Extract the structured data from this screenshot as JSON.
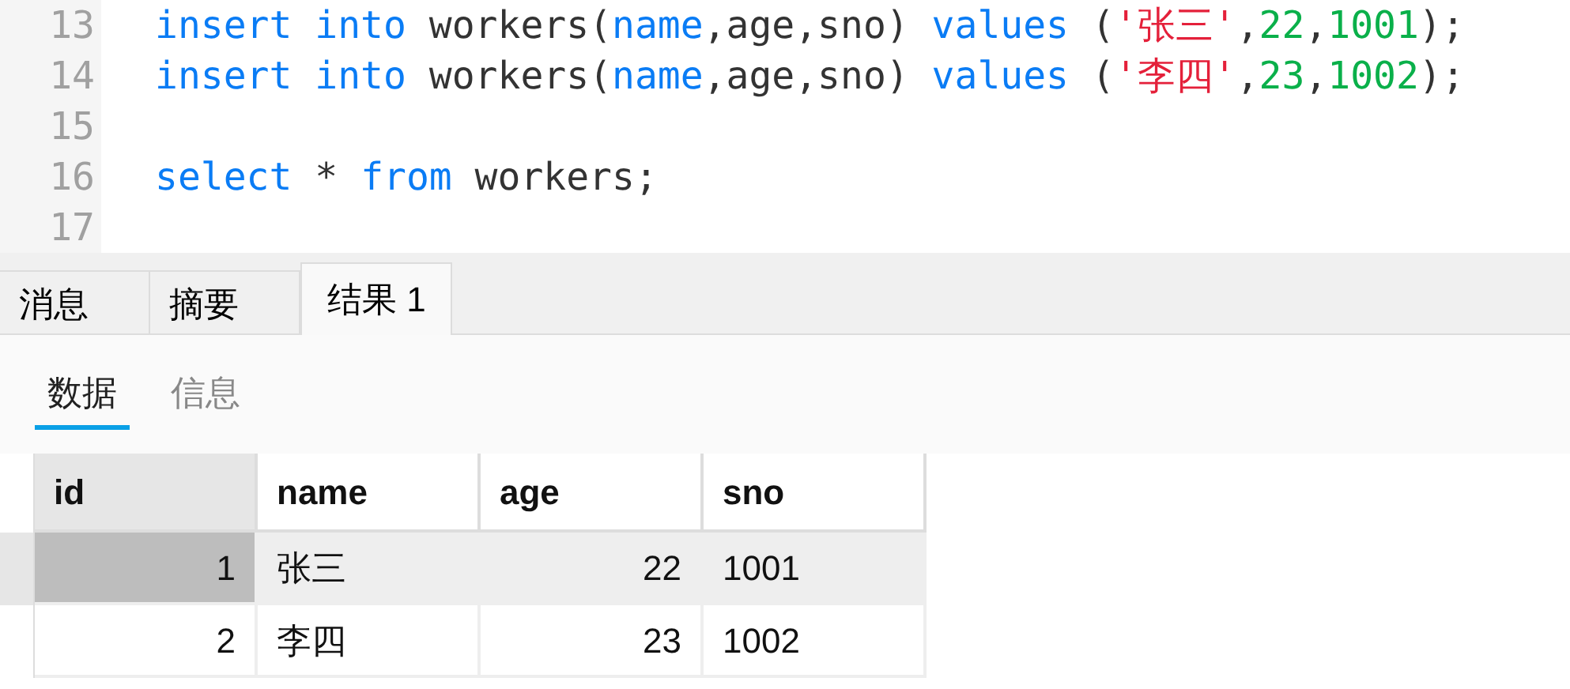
{
  "editor": {
    "lines": [
      {
        "number": "13",
        "tokens": [
          {
            "kind": "keyword",
            "text": "insert into"
          },
          {
            "kind": "plain",
            "text": " workers("
          },
          {
            "kind": "keyword",
            "text": "name"
          },
          {
            "kind": "plain",
            "text": ",age,sno) "
          },
          {
            "kind": "keyword",
            "text": "values"
          },
          {
            "kind": "plain",
            "text": " ("
          },
          {
            "kind": "string",
            "text": "'张三'"
          },
          {
            "kind": "plain",
            "text": ","
          },
          {
            "kind": "number",
            "text": "22"
          },
          {
            "kind": "plain",
            "text": ","
          },
          {
            "kind": "number",
            "text": "1001"
          },
          {
            "kind": "plain",
            "text": ");"
          }
        ]
      },
      {
        "number": "14",
        "tokens": [
          {
            "kind": "keyword",
            "text": "insert into"
          },
          {
            "kind": "plain",
            "text": " workers("
          },
          {
            "kind": "keyword",
            "text": "name"
          },
          {
            "kind": "plain",
            "text": ",age,sno) "
          },
          {
            "kind": "keyword",
            "text": "values"
          },
          {
            "kind": "plain",
            "text": " ("
          },
          {
            "kind": "string",
            "text": "'李四'"
          },
          {
            "kind": "plain",
            "text": ","
          },
          {
            "kind": "number",
            "text": "23"
          },
          {
            "kind": "plain",
            "text": ","
          },
          {
            "kind": "number",
            "text": "1002"
          },
          {
            "kind": "plain",
            "text": ");"
          }
        ]
      },
      {
        "number": "15"
      },
      {
        "number": "16",
        "tokens": [
          {
            "kind": "keyword",
            "text": "select"
          },
          {
            "kind": "plain",
            "text": " * "
          },
          {
            "kind": "keyword",
            "text": "from"
          },
          {
            "kind": "plain",
            "text": " workers;"
          }
        ]
      },
      {
        "number": "17"
      }
    ]
  },
  "result_tabs": [
    {
      "label": "消息",
      "selected": false
    },
    {
      "label": "摘要",
      "selected": false
    },
    {
      "label": "结果 1",
      "selected": true
    }
  ],
  "view_tabs": [
    {
      "label": "数据",
      "selected": true
    },
    {
      "label": "信息",
      "selected": false
    }
  ],
  "table": {
    "columns": [
      {
        "label": "id",
        "numeric": true,
        "selected": true
      },
      {
        "label": "name",
        "numeric": false,
        "selected": false
      },
      {
        "label": "age",
        "numeric": true,
        "selected": false
      },
      {
        "label": "sno",
        "numeric": false,
        "selected": false
      }
    ],
    "rows": [
      {
        "selected": true,
        "cells": [
          "1",
          "张三",
          "22",
          "1001"
        ]
      },
      {
        "selected": false,
        "cells": [
          "2",
          "李四",
          "23",
          "1002"
        ]
      }
    ]
  }
}
